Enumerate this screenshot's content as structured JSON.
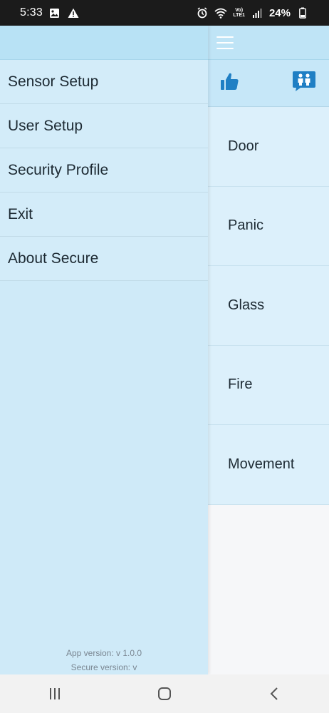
{
  "status_bar": {
    "time": "5:33",
    "battery_percent": "24%",
    "volte_top": "Vo)",
    "volte_bottom": "LTE1"
  },
  "drawer": {
    "items": [
      {
        "label": "Sensor Setup"
      },
      {
        "label": "User Setup"
      },
      {
        "label": "Security Profile"
      },
      {
        "label": "Exit"
      },
      {
        "label": "About Secure"
      }
    ],
    "footer": {
      "app_version": "App version: v 1.0.0",
      "secure_version": "Secure version: v"
    }
  },
  "main": {
    "sensors": [
      {
        "label": "Door"
      },
      {
        "label": "Panic"
      },
      {
        "label": "Glass"
      },
      {
        "label": "Fire"
      },
      {
        "label": "Movement"
      }
    ]
  },
  "icons": {
    "menu": "hamburger-icon",
    "like": "thumbs-up-icon",
    "users": "users-chat-icon",
    "nav_recents": "recent-apps-icon",
    "nav_home": "home-icon",
    "nav_back": "back-icon"
  },
  "colors": {
    "accent": "#1f7fc4",
    "drawer_bg": "#cfeaf8",
    "item_bg": "#dcf0fb",
    "status_bar": "#1b1b1b"
  }
}
